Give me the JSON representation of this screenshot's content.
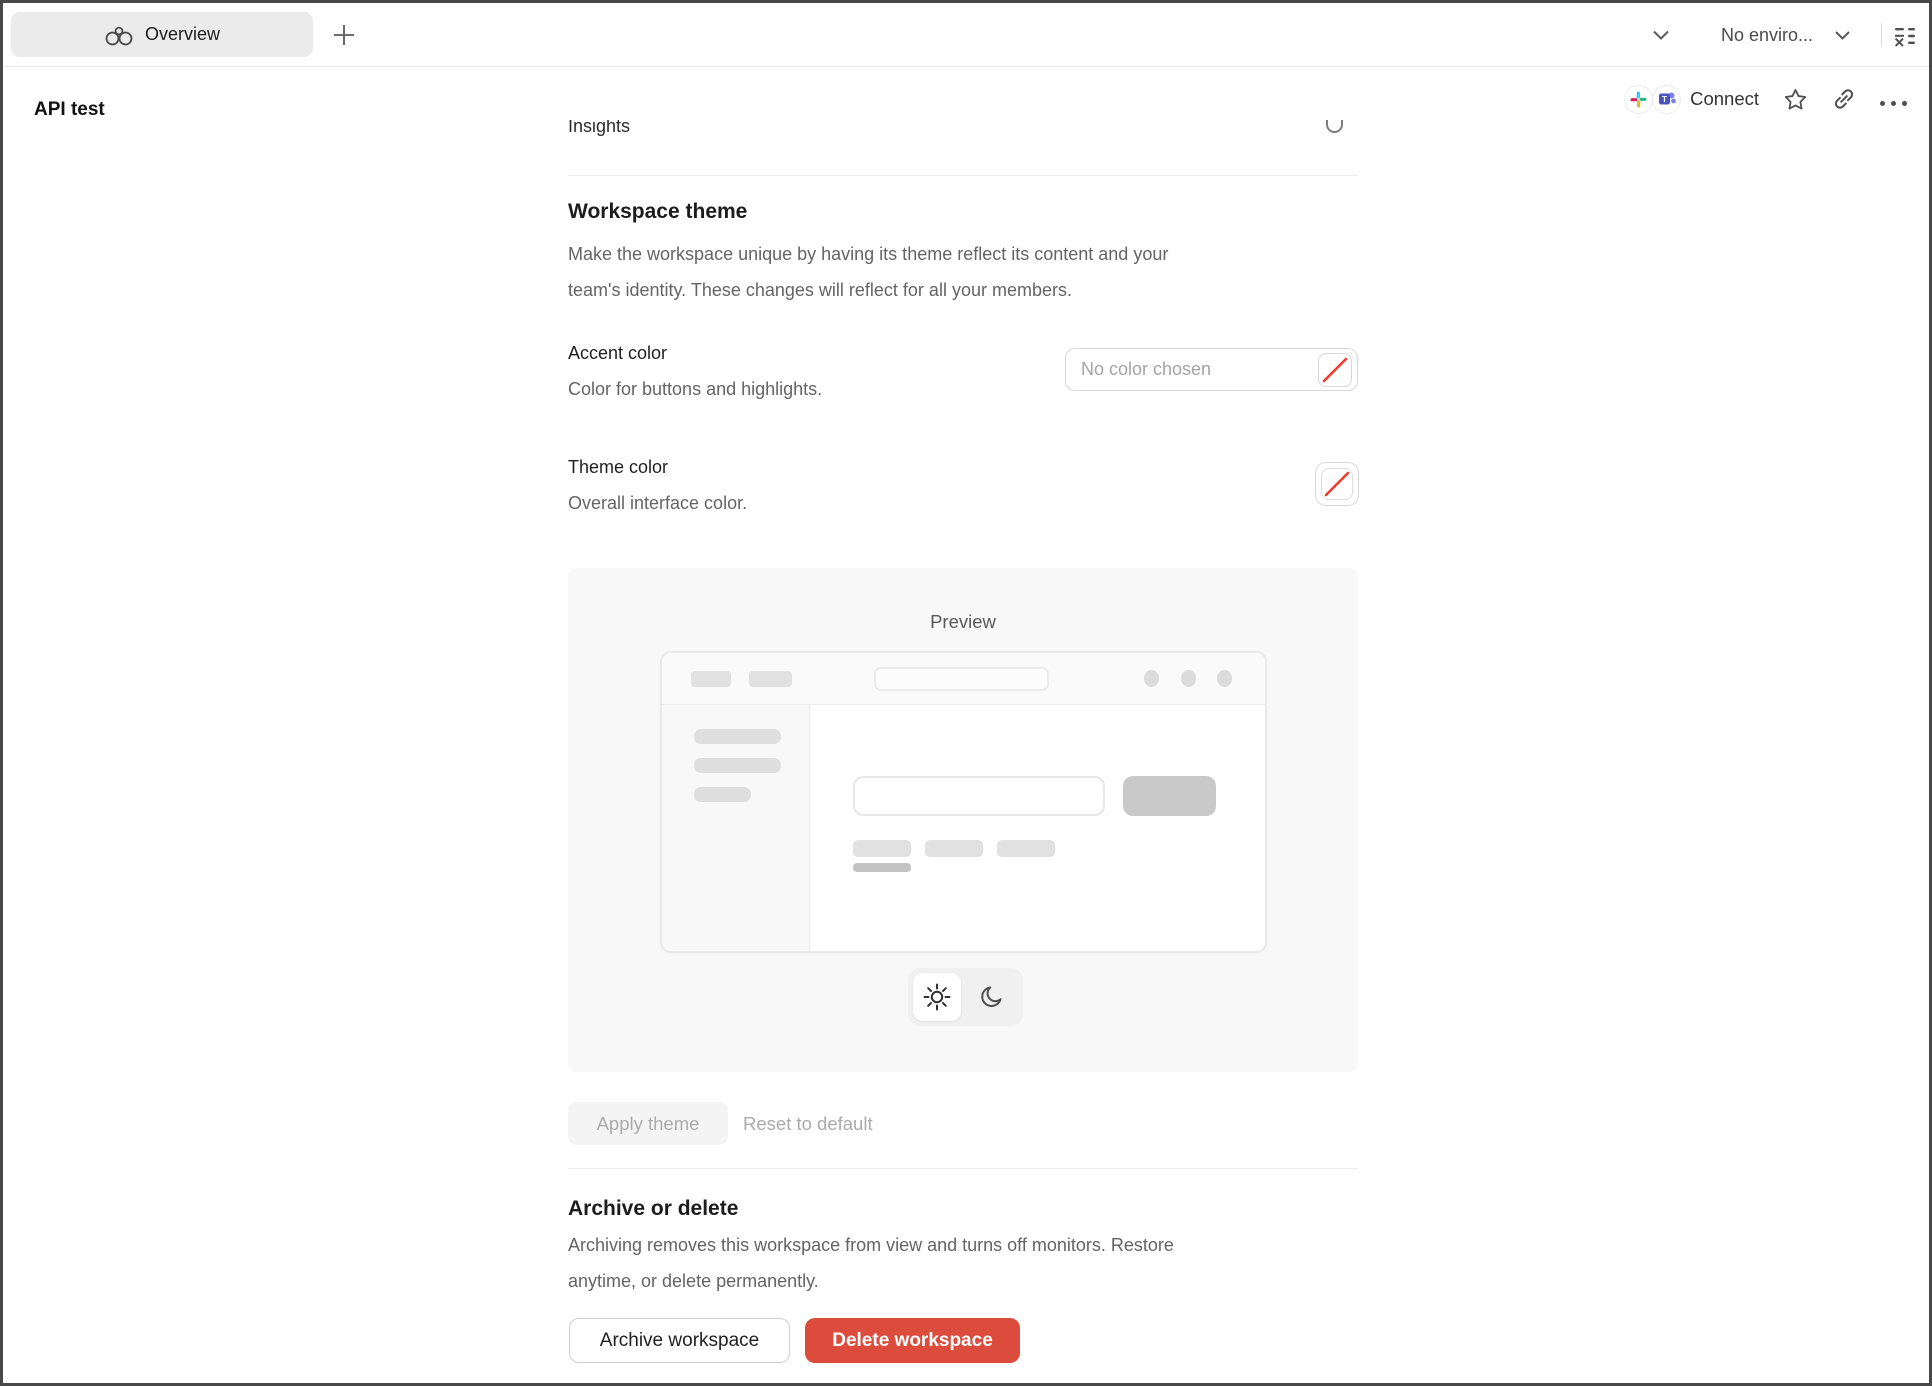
{
  "topbar": {
    "tab_label": "Overview",
    "env_label": "No enviro..."
  },
  "header": {
    "title": "API test",
    "connect_label": "Connect"
  },
  "content": {
    "insights_label": "Insights"
  },
  "theme": {
    "heading": "Workspace theme",
    "desc_lines": [
      "Make the workspace unique by having its theme reflect its content and your",
      "team's identity. These changes will reflect for all your members."
    ],
    "accent": {
      "label": "Accent color",
      "desc": "Color for buttons and highlights.",
      "placeholder": "No color chosen"
    },
    "theme_color": {
      "label": "Theme color",
      "desc": "Overall interface color."
    },
    "preview_label": "Preview",
    "apply_label": "Apply theme",
    "reset_label": "Reset to default"
  },
  "danger": {
    "heading": "Archive or delete",
    "desc_lines": [
      "Archiving removes this workspace from view and turns off monitors. Restore",
      "anytime, or delete permanently."
    ],
    "archive_label": "Archive workspace",
    "delete_label": "Delete workspace"
  },
  "icons": {
    "plus": "+",
    "ellipsis": "...",
    "overview": "binoculars",
    "light_mode": "sun",
    "dark_mode": "moon"
  },
  "colors": {
    "delete_red": "#dc4c3c",
    "no_color_slash_red": "#f13b2d",
    "tab_pill_gray": "#ebebeb",
    "preview_card_gray": "#f8f8f8"
  }
}
